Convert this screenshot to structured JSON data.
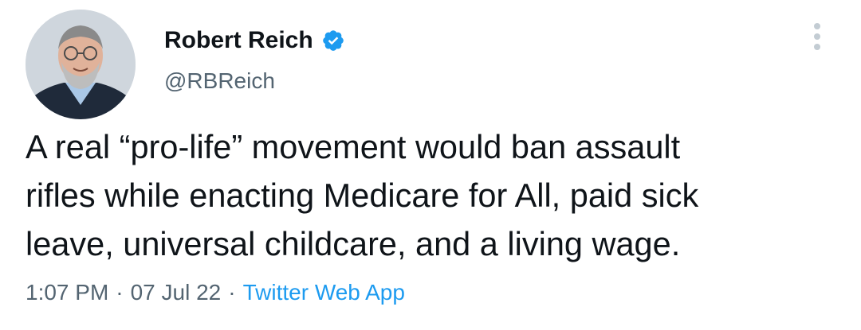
{
  "author": {
    "display_name": "Robert Reich",
    "handle": "@RBReich",
    "verified_icon": "verified-badge-icon",
    "avatar_icon": "profile-photo"
  },
  "tweet": {
    "text_lines": [
      "A real “pro-life” movement would ban assault",
      "rifles while enacting Medicare for All, paid sick",
      "leave, universal childcare, and a living wage."
    ],
    "time": "1:07 PM",
    "separator": "·",
    "date": "07 Jul 22",
    "source": "Twitter Web App"
  },
  "menu": {
    "icon": "more-options-icon"
  },
  "colors": {
    "text": "#0f1419",
    "secondary": "#536471",
    "accent": "#1d9bf0"
  }
}
